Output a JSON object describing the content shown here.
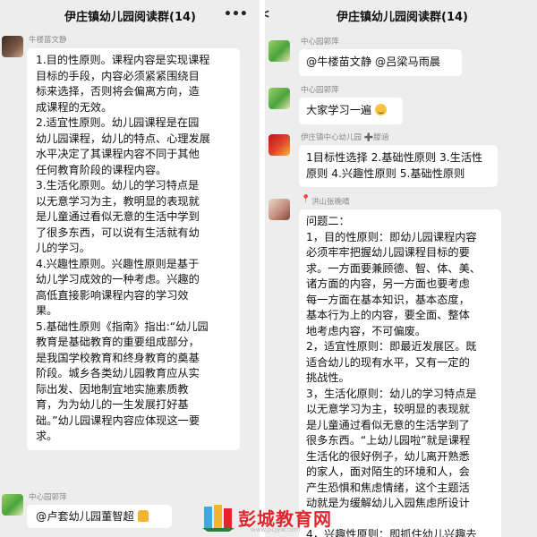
{
  "left": {
    "title": "伊庄镇幼儿园阅读群(14)",
    "msg1": {
      "sender": "牛楼苗文静",
      "lines": [
        "1.目的性原则。课程内容是实现课程",
        "目标的手段，内容必须紧紧围绕目",
        "标来选择，否则将会偏离方向，造",
        "成课程的无效。",
        "2.适宜性原则。幼儿园课程是在园",
        "幼儿园课程，幼儿的特点、心理发展",
        "水平决定了其课程内容不同于其他",
        "任何教育阶段的课程内容。",
        "3.生活化原则。幼儿的学习特点是",
        "以无意学习为主，教明显的表现就",
        "是儿童通过看似无意的生活中学到",
        "了很多东西，可以说有生活就有幼",
        "儿的学习。",
        "4.兴趣性原则。兴趣性原则是基于",
        "幼儿学习成效的一种考虑。兴趣的",
        "高低直接影响课程内容的学习效",
        "果。",
        "5.基础性原则《指南》指出:“幼儿园",
        "教育是基础教育的重要组成部分，",
        "是我国学校教育和终身教育的奠基",
        "阶段。城乡各类幼儿园教育应从实",
        "际出发、因地制宜地实施素质教",
        "育，为为幼儿的一生发展打好基",
        "础。”幼儿园课程内容应体现这一要",
        "求。"
      ]
    },
    "msg2": {
      "sender": "中心园郭萍",
      "text": "@卢套幼儿园董智超"
    }
  },
  "right": {
    "title": "伊庄镇幼儿园阅读群(14)",
    "msg1": {
      "sender": "中心园郭萍",
      "text": "@牛楼苗文静 @吕梁马雨晨"
    },
    "msg2": {
      "sender": "中心园郭萍",
      "text": "大家学习一遍"
    },
    "msg3": {
      "sender": "伊庄镇中心幼儿园 ➕滕涵",
      "lines": [
        "1目标性选择 2.基础性原则 3.生活性",
        "原则 4.兴趣性原则 5.基础性原则"
      ]
    },
    "msg4": {
      "sender": "洪山张晚晴",
      "lines": [
        "问题二：",
        "1，目的性原则：即幼儿园课程内容",
        "必须牢牢把握幼儿园课程目标的要",
        "求。一方面要兼顾德、智、体、美、",
        "诸方面的内容，另一方面也要考虑",
        "每一方面在基本知识，基本态度，",
        "基本行为上的内容，要全面、整体",
        "地考虑内容，不可偏废。",
        "2，适宜性原则：即最近发展区。既",
        "适合幼儿的现有水平，又有一定的",
        "挑战性。",
        "3，生活化原则：幼儿的学习特点是",
        "以无意学习为主，较明显的表现就",
        "是儿童通过看似无意的生活学到了",
        "很多东西。“上幼儿园啦”就是课程",
        "生活化的很好例子，幼儿离开熟悉",
        "的家人，面对陌生的环境和人，会",
        "产生恐惧和焦虑情绪，这个主题活",
        "动就是为缓解幼儿入园焦虑所设计",
        "",
        "4，兴趣性原则：即抓住幼儿兴趣去"
      ]
    }
  },
  "watermark": {
    "text": "彭城教育网",
    "url": "www.pcjyw.com"
  }
}
